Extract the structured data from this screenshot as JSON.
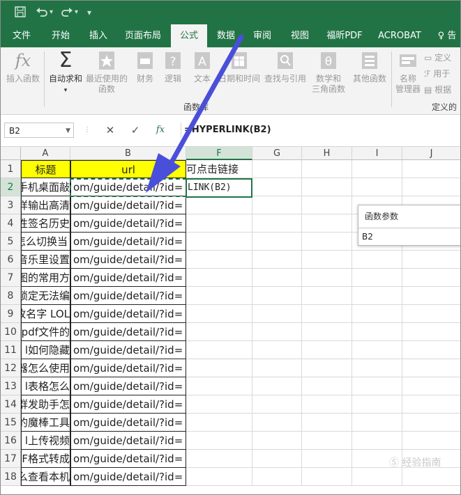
{
  "quick_access": {
    "save_icon": "save-icon",
    "undo_icon": "undo-icon",
    "redo_icon": "redo-icon",
    "customize": "₹"
  },
  "tabs": [
    {
      "label": "文件"
    },
    {
      "label": "开始"
    },
    {
      "label": "插入"
    },
    {
      "label": "页面布局"
    },
    {
      "label": "公式",
      "active": true
    },
    {
      "label": "数据"
    },
    {
      "label": "审阅"
    },
    {
      "label": "视图"
    },
    {
      "label": "福昕PDF"
    },
    {
      "label": "ACROBAT"
    },
    {
      "label": "♀ 告"
    }
  ],
  "ribbon": {
    "insert_function": {
      "icon": "fx",
      "label": "插入函数"
    },
    "autosum": {
      "icon": "Σ",
      "label": "自动求和"
    },
    "recent": {
      "label1": "最近使用的",
      "label2": "函数"
    },
    "financial": {
      "label": "财务"
    },
    "logical": {
      "label": "逻辑"
    },
    "text": {
      "label": "文本"
    },
    "datetime": {
      "label": "日期和时间"
    },
    "lookup": {
      "label": "查找与引用"
    },
    "math": {
      "label1": "数学和",
      "label2": "三角函数"
    },
    "more": {
      "label": "其他函数"
    },
    "group_label": "函数库",
    "name_manager": {
      "label1": "名称",
      "label2": "管理器"
    },
    "define_name": "定义",
    "use_in": "用于",
    "create_from": "根据",
    "group_label2": "定义的"
  },
  "formula_bar": {
    "name_box": "B2",
    "cancel": "✕",
    "enter": "✓",
    "fx": "fx",
    "formula": "=HYPERLINK(B2)"
  },
  "columns": [
    {
      "label": "A"
    },
    {
      "label": "B"
    },
    {
      "label": "F",
      "selected": true
    },
    {
      "label": "G"
    },
    {
      "label": "H"
    },
    {
      "label": "I"
    },
    {
      "label": "J"
    }
  ],
  "header_row": {
    "a": "标题",
    "b": "url",
    "f": "可点击链接"
  },
  "active_cell_text": "LINK(B2)",
  "rows": [
    {
      "n": "1"
    },
    {
      "n": "2",
      "a": "影手机桌面敲",
      "b": "om/guide/detail/?id="
    },
    {
      "n": "3",
      "a": "样输出高清",
      "b": "om/guide/detail/?id="
    },
    {
      "n": "4",
      "a": "性签名历史",
      "b": "om/guide/detail/?id="
    },
    {
      "n": "5",
      "a": " 怎么切换当",
      "b": "om/guide/detail/?id="
    },
    {
      "n": "6",
      "a": "的音乐里设置",
      "b": "om/guide/detail/?id="
    },
    {
      "n": "7",
      "a": "图的常用方",
      "b": "om/guide/detail/?id="
    },
    {
      "n": "8",
      "a": "锁定无法编",
      "b": "om/guide/detail/?id="
    },
    {
      "n": "9",
      "a": "改名字 LOL",
      "b": "om/guide/detail/?id="
    },
    {
      "n": "10",
      "a": "pdf文件的",
      "b": "om/guide/detail/?id="
    },
    {
      "n": "11",
      "a": "l如何隐藏",
      "b": "om/guide/detail/?id="
    },
    {
      "n": "12",
      "a": "器怎么使用",
      "b": "om/guide/detail/?id="
    },
    {
      "n": "13",
      "a": "l表格怎么",
      "b": "om/guide/detail/?id="
    },
    {
      "n": "14",
      "a": "群发助手怎",
      "b": "om/guide/detail/?id="
    },
    {
      "n": "15",
      "a": "的魔棒工具",
      "b": "om/guide/detail/?id="
    },
    {
      "n": "16",
      "a": "l上传视频",
      "b": "om/guide/detail/?id="
    },
    {
      "n": "17",
      "a": "F格式转成",
      "b": "om/guide/detail/?id="
    },
    {
      "n": "18",
      "a": "么查看本机",
      "b": "om/guide/detail/?id="
    }
  ],
  "popup": {
    "title": "函数参数",
    "value": "B2"
  },
  "colors": {
    "excel_green": "#217346",
    "header_fill": "#ffff00",
    "arrow": "#4a4fd9"
  }
}
